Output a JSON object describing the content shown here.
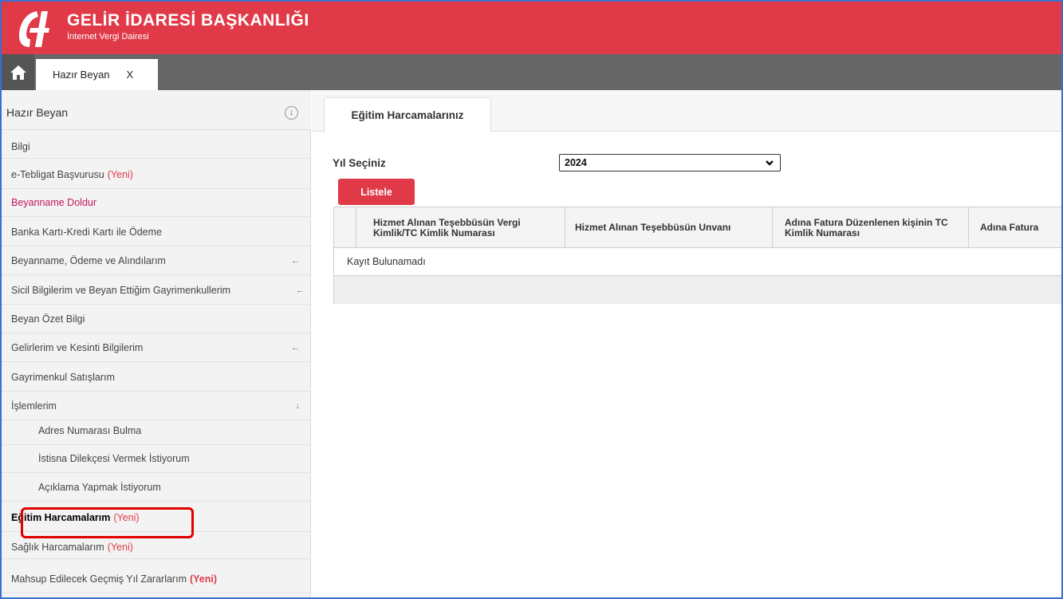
{
  "header": {
    "title": "GELİR İDARESİ BAŞKANLIĞI",
    "subtitle": "İnternet Vergi Dairesi"
  },
  "tabbar": {
    "home_icon": "home-icon",
    "open_tab_label": "Hazır Beyan",
    "close_label": "X"
  },
  "sidebar": {
    "title": "Hazır Beyan",
    "collapse_symbol": "↓",
    "items": [
      {
        "label": "Bilgi"
      },
      {
        "label": "e-Tebligat Başvurusu",
        "badge": "(Yeni)"
      },
      {
        "label": "Beyanname Doldur"
      },
      {
        "label": "Banka Kartı-Kredi Kartı ile Ödeme"
      },
      {
        "label": "Beyanname, Ödeme ve Alındılarım",
        "arrow": "←"
      },
      {
        "label": "Sicil Bilgilerim ve Beyan Ettiğim Gayrimenkullerim",
        "arrow": "←"
      },
      {
        "label": "Beyan Özet Bilgi"
      },
      {
        "label": "Gelirlerim ve Kesinti Bilgilerim",
        "arrow": "←"
      },
      {
        "label": "Gayrimenkul Satışlarım"
      },
      {
        "label": "İşlemlerim",
        "arrow": "↓"
      },
      {
        "label": "Adres Numarası Bulma"
      },
      {
        "label": "İstisna Dilekçesi Vermek İstiyorum"
      },
      {
        "label": "Açıklama Yapmak İstiyorum"
      },
      {
        "label": "Eğitim Harcamalarım",
        "badge": "(Yeni)"
      },
      {
        "label": "Sağlık Harcamalarım",
        "badge": "(Yeni)"
      },
      {
        "label": "Mahsup Edilecek Geçmiş Yıl Zararlarım",
        "badge": "(Yeni)"
      }
    ]
  },
  "content": {
    "tab_label": "Eğitim Harcamalarınız",
    "year_label": "Yıl Seçiniz",
    "year_value": "2024",
    "list_button": "Listele",
    "grid": {
      "columns": [
        "Hizmet Alınan Teşebbüsün Vergi Kimlik/TC Kimlik Numarası",
        "Hizmet Alınan Teşebbüsün Unvanı",
        "Adına Fatura Düzenlenen kişinin TC Kimlik Numarası",
        "Adına Fatura"
      ],
      "empty_message": "Kayıt Bulunamadı"
    }
  },
  "colors": {
    "brand_red": "#e03a48",
    "tabbar_gray": "#666666",
    "highlight_red": "#e00000"
  }
}
